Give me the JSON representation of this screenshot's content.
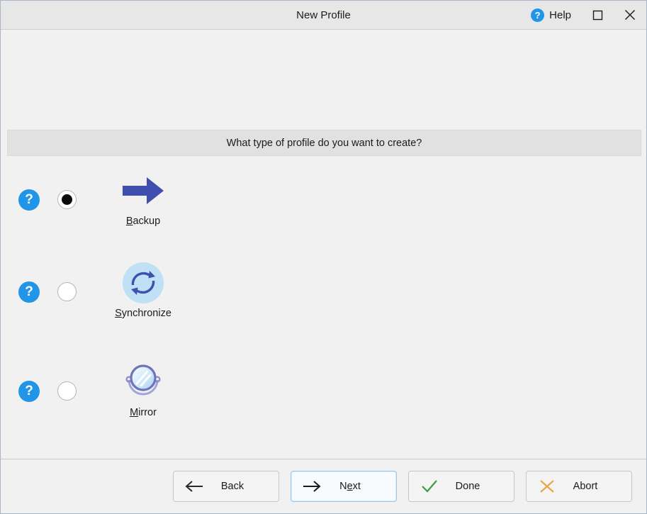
{
  "window": {
    "title": "New Profile",
    "help_label": "Help",
    "help_icon": "question-circle-icon",
    "maximize_icon": "maximize-square-icon",
    "close_icon": "close-x-icon"
  },
  "prompt": {
    "text": "What type of profile do you want to create?"
  },
  "options": [
    {
      "label": "Backup",
      "mnemonic": "B",
      "rest": "ackup",
      "icon": "blue-right-arrow-icon",
      "help_icon": "question-circle-icon",
      "selected": true
    },
    {
      "label": "Synchronize",
      "mnemonic": "S",
      "rest": "ynchronize",
      "icon": "sync-circular-arrows-icon",
      "help_icon": "question-circle-icon",
      "selected": false
    },
    {
      "label": "Mirror",
      "mnemonic": "M",
      "rest": "irror",
      "icon": "hand-mirror-icon",
      "help_icon": "question-circle-icon",
      "selected": false
    }
  ],
  "buttons": [
    {
      "label": "Back",
      "mnemonic": "",
      "pre": "Back",
      "post": "",
      "icon": "arrow-left-icon",
      "focused": false
    },
    {
      "label": "Next",
      "mnemonic": "e",
      "pre": "N",
      "post": "xt",
      "icon": "arrow-right-icon",
      "focused": true
    },
    {
      "label": "Done",
      "mnemonic": "",
      "pre": "Done",
      "post": "",
      "icon": "check-icon",
      "focused": false
    },
    {
      "label": "Abort",
      "mnemonic": "",
      "pre": "Abort",
      "post": "",
      "icon": "x-cross-icon",
      "focused": false
    }
  ],
  "colors": {
    "help_blue": "#2196e8",
    "arrow_indigo": "#3f4fad",
    "sync_bg": "#bfe0f5",
    "mirror_ring": "#7b7fc4",
    "done_green": "#3f9a41",
    "abort_orange": "#e8a845",
    "window_bg": "#f1f1f1",
    "banner_bg": "#e1e1e1"
  }
}
